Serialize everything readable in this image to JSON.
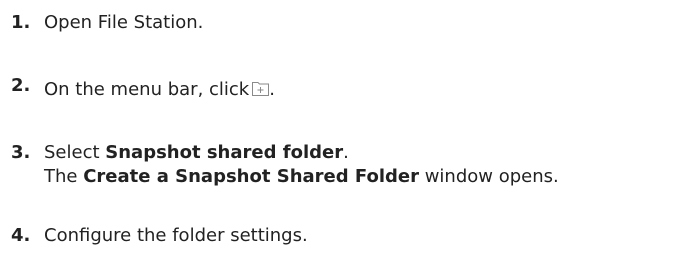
{
  "steps": [
    {
      "number": "1.",
      "text": "Open File Station."
    },
    {
      "number": "2.",
      "text_before_icon": "On the menu bar, click",
      "icon": "create-folder-icon",
      "text_after_icon": "."
    },
    {
      "number": "3.",
      "line1_prefix": "Select",
      "line1_bold": "Snapshot shared folder",
      "line1_suffix": ".",
      "line2_prefix": "The",
      "line2_bold": "Create a Snapshot Shared Folder",
      "line2_suffix": "window opens."
    },
    {
      "number": "4.",
      "text": "Configure the folder settings."
    }
  ]
}
